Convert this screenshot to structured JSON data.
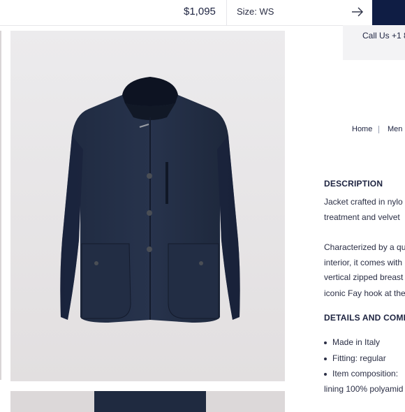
{
  "topbar": {
    "price": "$1,095",
    "size_label": "Size: WS",
    "arrow_icon": "arrow-right-icon",
    "accent_color": "#0f1d44"
  },
  "contact": {
    "call_text": "Call Us +1 8"
  },
  "breadcrumb": {
    "items": [
      "Home",
      "Men"
    ]
  },
  "description": {
    "heading": "DESCRIPTION",
    "lines": [
      "Jacket crafted in nylo",
      "treatment and velvet"
    ],
    "lines2": [
      "Characterized by a qu",
      "interior, it comes with",
      "vertical zipped breast",
      "iconic Fay hook at the"
    ]
  },
  "details": {
    "heading": "DETAILS AND COMP",
    "bullets": [
      "Made in Italy",
      "Fitting: regular",
      "Item composition:"
    ],
    "continuation": "lining 100% polyamid"
  }
}
